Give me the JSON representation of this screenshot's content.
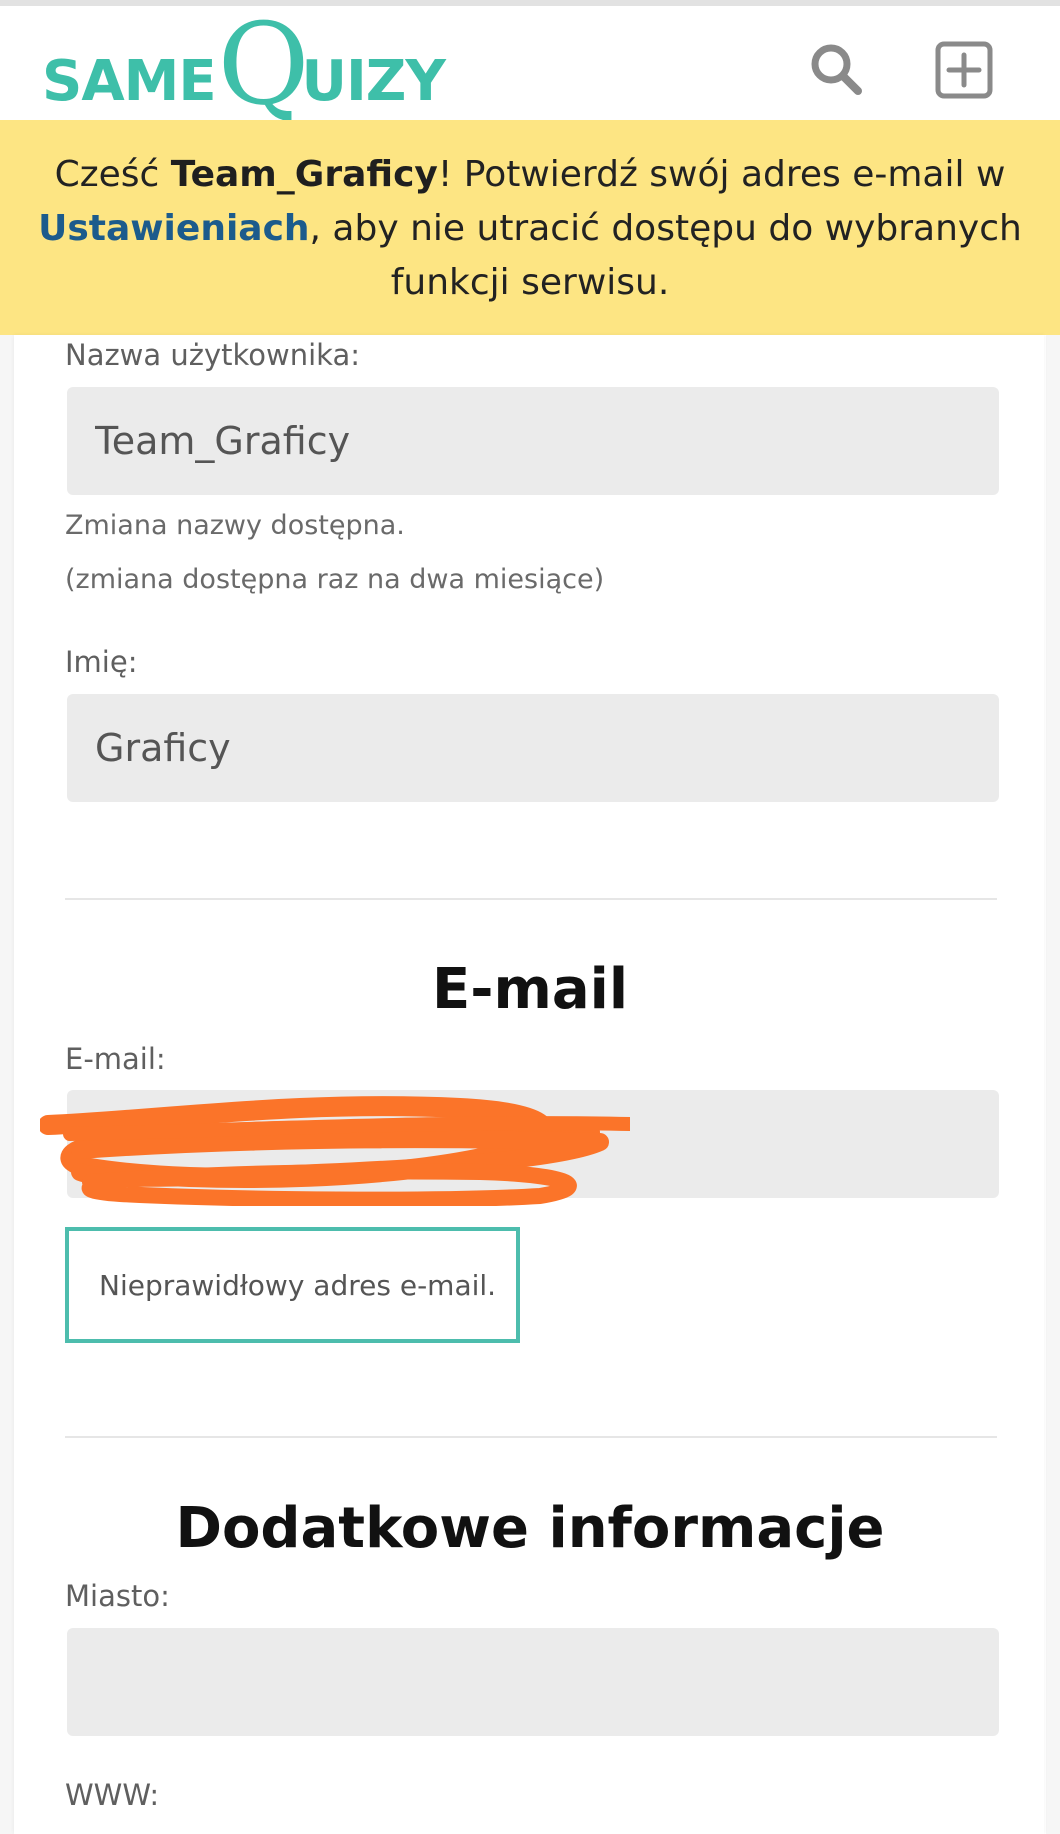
{
  "header": {
    "logo": {
      "same": "SAME",
      "q": "Q",
      "uizy": "UIZY"
    },
    "icons": {
      "search": "search-icon",
      "add": "plus-square-icon"
    }
  },
  "banner": {
    "greeting": "Cześć ",
    "username": "Team_Graficy",
    "message_part1": "! Potwierdź swój adres e-mail w ",
    "settings_link": "Ustawieniach",
    "message_part2": ", aby nie utracić dostępu do wybranych funkcji serwisu."
  },
  "profile": {
    "username_label": "Nazwa użytkownika:",
    "username_value": "Team_Graficy",
    "username_hint1": "Zmiana nazwy dostępna.",
    "username_hint2": "(zmiana dostępna raz na dwa miesiące)",
    "name_label": "Imię:",
    "name_value": "Graficy"
  },
  "email_section": {
    "title": "E-mail",
    "email_label": "E-mail:",
    "email_value": "",
    "error_message": "Nieprawidłowy adres e-mail."
  },
  "additional_section": {
    "title": "Dodatkowe informacje",
    "city_label": "Miasto:",
    "city_value": "",
    "www_label": "WWW:"
  },
  "colors": {
    "brand": "#3ebfa9",
    "banner_bg": "#fde583",
    "link": "#1c5b8c",
    "redaction": "#fb7429",
    "error_border": "#4dbdad"
  }
}
